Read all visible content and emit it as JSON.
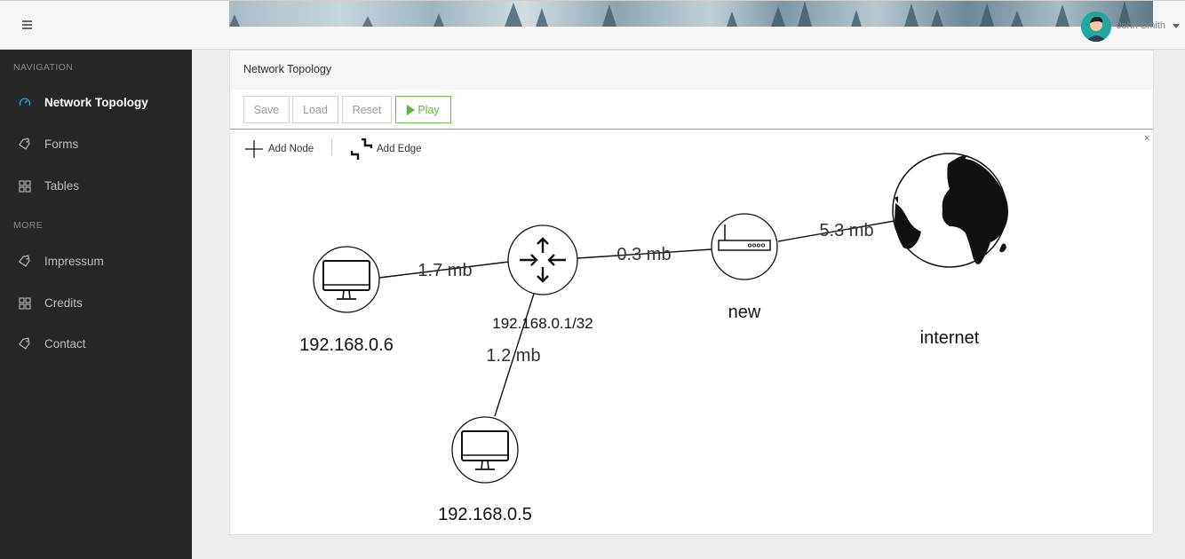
{
  "header": {
    "menu_icon": "hamburger-icon",
    "user": {
      "name": "John Smith",
      "avatar_icon": "user-avatar-icon"
    }
  },
  "sidebar": {
    "sections": [
      {
        "label": "NAVIGATION"
      },
      {
        "label": "MORE"
      }
    ],
    "items": [
      {
        "label": "Network Topology",
        "icon": "gauge-icon",
        "active": true
      },
      {
        "label": "Forms",
        "icon": "tag-icon"
      },
      {
        "label": "Tables",
        "icon": "grid-icon"
      },
      {
        "label": "Impressum",
        "icon": "tag-icon"
      },
      {
        "label": "Credits",
        "icon": "grid-icon"
      },
      {
        "label": "Contact",
        "icon": "tag-icon"
      }
    ]
  },
  "panel": {
    "title": "Network Topology",
    "buttons": {
      "save": "Save",
      "load": "Load",
      "reset": "Reset",
      "play": "Play"
    },
    "tools": {
      "add_node": "Add Node",
      "add_edge": "Add Edge"
    },
    "close_label": "×"
  },
  "graph": {
    "nodes": [
      {
        "id": "pc6",
        "label": "192.168.0.6",
        "type": "computer"
      },
      {
        "id": "router",
        "label": "192.168.0.1/32",
        "type": "router"
      },
      {
        "id": "pc5",
        "label": "192.168.0.5",
        "type": "computer"
      },
      {
        "id": "modem",
        "label": "new",
        "type": "modem"
      },
      {
        "id": "internet",
        "label": "internet",
        "type": "globe"
      }
    ],
    "edges": [
      {
        "from": "pc6",
        "to": "router",
        "label": "1.7 mb"
      },
      {
        "from": "router",
        "to": "pc5",
        "label": "1.2 mb"
      },
      {
        "from": "router",
        "to": "modem",
        "label": "0.3 mb"
      },
      {
        "from": "modem",
        "to": "internet",
        "label": "5.3 mb"
      }
    ]
  },
  "colors": {
    "accent": "#1fa7d6",
    "play": "#5cb83c",
    "sidebar_bg": "#262626"
  }
}
